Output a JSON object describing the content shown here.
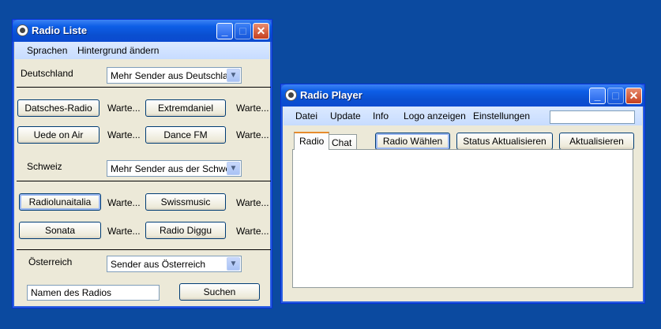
{
  "radio_liste": {
    "title": "Radio Liste",
    "menu": [
      "Sprachen",
      "Hintergrund ändern"
    ],
    "sections": [
      {
        "label": "Deutschland",
        "select_value": "Mehr Sender aus Deutschland",
        "stations": [
          {
            "name": "Datsches-Radio",
            "status": "Warte..."
          },
          {
            "name": "Extremdaniel",
            "status": "Warte..."
          },
          {
            "name": "Uede on Air",
            "status": "Warte..."
          },
          {
            "name": "Dance FM",
            "status": "Warte..."
          }
        ]
      },
      {
        "label": "Schweiz",
        "select_value": "Mehr Sender aus der Schweiz",
        "stations": [
          {
            "name": "Radiolunaitalia",
            "status": "Warte..."
          },
          {
            "name": "Swissmusic",
            "status": "Warte..."
          },
          {
            "name": "Sonata",
            "status": "Warte..."
          },
          {
            "name": "Radio Diggu",
            "status": "Warte..."
          }
        ]
      },
      {
        "label": "Österreich",
        "select_value": "Sender aus Österreich"
      }
    ],
    "search_input_value": "Namen des Radios",
    "search_button": "Suchen"
  },
  "radio_player": {
    "title": "Radio Player",
    "menu": [
      "Datei",
      "Update",
      "Info",
      "Logo anzeigen",
      "Einstellungen"
    ],
    "menu_input_value": "",
    "tabs": [
      "Radio",
      "Chat"
    ],
    "active_tab": "Radio",
    "buttons": [
      "Radio Wählen",
      "Status Aktualisieren",
      "Aktualisieren"
    ]
  },
  "colors": {
    "desktop": "#0b4aa0",
    "titlebar": "#0a4fd0",
    "window_bg": "#ece9d8",
    "menubar": "#c7dcff",
    "tab_accent": "#e68b2c"
  },
  "icons": [
    "radio-icon",
    "minimize-icon",
    "maximize-icon",
    "close-icon",
    "dropdown-arrow-icon"
  ]
}
